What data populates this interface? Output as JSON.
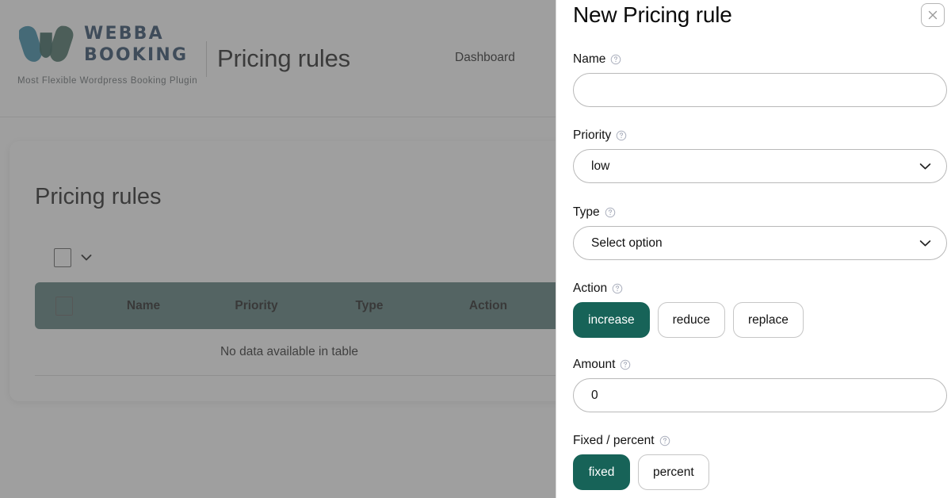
{
  "brand": {
    "name_line1": "WEBBA",
    "name_line2": "BOOKING",
    "tagline": "Most Flexible Wordpress Booking Plugin",
    "logo_left_color": "#1f7a9c",
    "logo_right_color": "#2f5d4f",
    "text_color": "#1b3a5c"
  },
  "header": {
    "page_title": "Pricing rules",
    "nav": [
      {
        "label": "Dashboard"
      }
    ]
  },
  "card": {
    "title": "Pricing rules",
    "bulk": {
      "checkbox_checked": false,
      "dropdown_icon": "chevron-down-icon"
    },
    "table": {
      "columns": [
        "Name",
        "Priority",
        "Type",
        "Action"
      ],
      "header_bg": "#4e7470",
      "empty_message": "No data available in table",
      "rows": []
    }
  },
  "panel": {
    "title": "New Pricing rule",
    "close_icon": "close-icon",
    "accent_color": "#176358",
    "fields": {
      "name": {
        "label": "Name",
        "value": "",
        "placeholder": "",
        "help_icon": "help-circle-icon"
      },
      "priority": {
        "label": "Priority",
        "value": "low",
        "help_icon": "help-circle-icon",
        "options": [
          "low"
        ]
      },
      "type": {
        "label": "Type",
        "value": "Select option",
        "help_icon": "help-circle-icon",
        "options": [
          "Select option"
        ]
      },
      "action": {
        "label": "Action",
        "help_icon": "help-circle-icon",
        "selected": "increase",
        "options": [
          "increase",
          "reduce",
          "replace"
        ]
      },
      "amount": {
        "label": "Amount",
        "value": "0",
        "placeholder": "",
        "help_icon": "help-circle-icon"
      },
      "fixed_percent": {
        "label": "Fixed / percent",
        "help_icon": "help-circle-icon",
        "selected": "fixed",
        "options": [
          "fixed",
          "percent"
        ]
      }
    }
  }
}
